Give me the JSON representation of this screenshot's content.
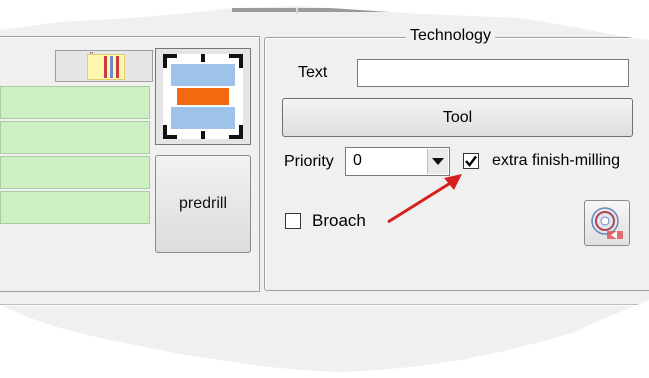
{
  "group": {
    "title": "Technology"
  },
  "text_field": {
    "label": "Text",
    "value": ""
  },
  "tool_button": {
    "label": "Tool"
  },
  "priority": {
    "label": "Priority",
    "selected": "0"
  },
  "extra_finish": {
    "label": "extra finish-milling",
    "checked": true,
    "check_glyph": "✔"
  },
  "broach": {
    "label": "Broach",
    "checked": false
  },
  "predrill_button": {
    "label": "predrill"
  },
  "icons": {
    "milling": "milling-operation-icon",
    "toolbar": "toolbar-ruler-icon",
    "cd": "cd-load-icon",
    "annotation": "red-arrow-annotation"
  },
  "colors": {
    "green_rows": "#ccf0c4",
    "milling_orange": "#f26a10",
    "milling_blue": "#9ec2ea",
    "arrow_red": "#d62020"
  }
}
